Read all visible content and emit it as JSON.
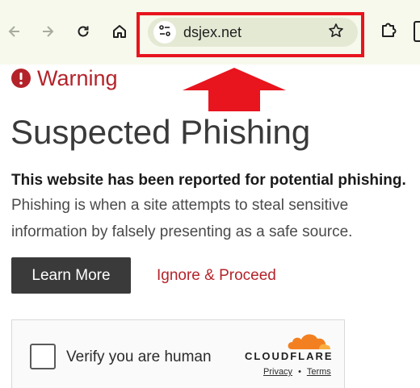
{
  "browser": {
    "url": "dsjex.net",
    "icons": {
      "back": "arrow-left-icon",
      "forward": "arrow-right-icon",
      "reload": "reload-icon",
      "home": "home-icon",
      "site_info": "tune-icon",
      "bookmark": "star-icon",
      "extensions": "puzzle-icon"
    }
  },
  "annotation": {
    "highlight_color": "#e8141e",
    "arrow_color": "#e8141e"
  },
  "warning": {
    "label": "Warning",
    "title": "Suspected Phishing",
    "lead": "This website has been reported for potential phishing.",
    "body_line1": "Phishing is when a site attempts to steal sensitive",
    "body_line2": "information by falsely presenting as a safe source.",
    "learn_more_label": "Learn More",
    "ignore_label": "Ignore & Proceed",
    "accent_color": "#b4232a"
  },
  "captcha": {
    "checkbox_label": "Verify you are human",
    "brand": "CLOUDFLARE",
    "privacy_label": "Privacy",
    "separator": "•",
    "terms_label": "Terms",
    "brand_color": "#f38020"
  }
}
